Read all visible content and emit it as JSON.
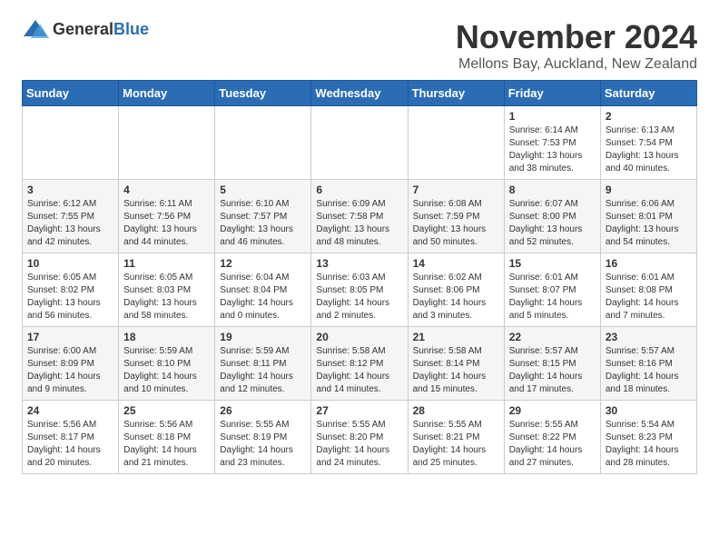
{
  "logo": {
    "text_general": "General",
    "text_blue": "Blue"
  },
  "header": {
    "month": "November 2024",
    "location": "Mellons Bay, Auckland, New Zealand"
  },
  "days_of_week": [
    "Sunday",
    "Monday",
    "Tuesday",
    "Wednesday",
    "Thursday",
    "Friday",
    "Saturday"
  ],
  "weeks": [
    [
      {
        "day": "",
        "info": ""
      },
      {
        "day": "",
        "info": ""
      },
      {
        "day": "",
        "info": ""
      },
      {
        "day": "",
        "info": ""
      },
      {
        "day": "",
        "info": ""
      },
      {
        "day": "1",
        "info": "Sunrise: 6:14 AM\nSunset: 7:53 PM\nDaylight: 13 hours\nand 38 minutes."
      },
      {
        "day": "2",
        "info": "Sunrise: 6:13 AM\nSunset: 7:54 PM\nDaylight: 13 hours\nand 40 minutes."
      }
    ],
    [
      {
        "day": "3",
        "info": "Sunrise: 6:12 AM\nSunset: 7:55 PM\nDaylight: 13 hours\nand 42 minutes."
      },
      {
        "day": "4",
        "info": "Sunrise: 6:11 AM\nSunset: 7:56 PM\nDaylight: 13 hours\nand 44 minutes."
      },
      {
        "day": "5",
        "info": "Sunrise: 6:10 AM\nSunset: 7:57 PM\nDaylight: 13 hours\nand 46 minutes."
      },
      {
        "day": "6",
        "info": "Sunrise: 6:09 AM\nSunset: 7:58 PM\nDaylight: 13 hours\nand 48 minutes."
      },
      {
        "day": "7",
        "info": "Sunrise: 6:08 AM\nSunset: 7:59 PM\nDaylight: 13 hours\nand 50 minutes."
      },
      {
        "day": "8",
        "info": "Sunrise: 6:07 AM\nSunset: 8:00 PM\nDaylight: 13 hours\nand 52 minutes."
      },
      {
        "day": "9",
        "info": "Sunrise: 6:06 AM\nSunset: 8:01 PM\nDaylight: 13 hours\nand 54 minutes."
      }
    ],
    [
      {
        "day": "10",
        "info": "Sunrise: 6:05 AM\nSunset: 8:02 PM\nDaylight: 13 hours\nand 56 minutes."
      },
      {
        "day": "11",
        "info": "Sunrise: 6:05 AM\nSunset: 8:03 PM\nDaylight: 13 hours\nand 58 minutes."
      },
      {
        "day": "12",
        "info": "Sunrise: 6:04 AM\nSunset: 8:04 PM\nDaylight: 14 hours\nand 0 minutes."
      },
      {
        "day": "13",
        "info": "Sunrise: 6:03 AM\nSunset: 8:05 PM\nDaylight: 14 hours\nand 2 minutes."
      },
      {
        "day": "14",
        "info": "Sunrise: 6:02 AM\nSunset: 8:06 PM\nDaylight: 14 hours\nand 3 minutes."
      },
      {
        "day": "15",
        "info": "Sunrise: 6:01 AM\nSunset: 8:07 PM\nDaylight: 14 hours\nand 5 minutes."
      },
      {
        "day": "16",
        "info": "Sunrise: 6:01 AM\nSunset: 8:08 PM\nDaylight: 14 hours\nand 7 minutes."
      }
    ],
    [
      {
        "day": "17",
        "info": "Sunrise: 6:00 AM\nSunset: 8:09 PM\nDaylight: 14 hours\nand 9 minutes."
      },
      {
        "day": "18",
        "info": "Sunrise: 5:59 AM\nSunset: 8:10 PM\nDaylight: 14 hours\nand 10 minutes."
      },
      {
        "day": "19",
        "info": "Sunrise: 5:59 AM\nSunset: 8:11 PM\nDaylight: 14 hours\nand 12 minutes."
      },
      {
        "day": "20",
        "info": "Sunrise: 5:58 AM\nSunset: 8:12 PM\nDaylight: 14 hours\nand 14 minutes."
      },
      {
        "day": "21",
        "info": "Sunrise: 5:58 AM\nSunset: 8:14 PM\nDaylight: 14 hours\nand 15 minutes."
      },
      {
        "day": "22",
        "info": "Sunrise: 5:57 AM\nSunset: 8:15 PM\nDaylight: 14 hours\nand 17 minutes."
      },
      {
        "day": "23",
        "info": "Sunrise: 5:57 AM\nSunset: 8:16 PM\nDaylight: 14 hours\nand 18 minutes."
      }
    ],
    [
      {
        "day": "24",
        "info": "Sunrise: 5:56 AM\nSunset: 8:17 PM\nDaylight: 14 hours\nand 20 minutes."
      },
      {
        "day": "25",
        "info": "Sunrise: 5:56 AM\nSunset: 8:18 PM\nDaylight: 14 hours\nand 21 minutes."
      },
      {
        "day": "26",
        "info": "Sunrise: 5:55 AM\nSunset: 8:19 PM\nDaylight: 14 hours\nand 23 minutes."
      },
      {
        "day": "27",
        "info": "Sunrise: 5:55 AM\nSunset: 8:20 PM\nDaylight: 14 hours\nand 24 minutes."
      },
      {
        "day": "28",
        "info": "Sunrise: 5:55 AM\nSunset: 8:21 PM\nDaylight: 14 hours\nand 25 minutes."
      },
      {
        "day": "29",
        "info": "Sunrise: 5:55 AM\nSunset: 8:22 PM\nDaylight: 14 hours\nand 27 minutes."
      },
      {
        "day": "30",
        "info": "Sunrise: 5:54 AM\nSunset: 8:23 PM\nDaylight: 14 hours\nand 28 minutes."
      }
    ]
  ]
}
